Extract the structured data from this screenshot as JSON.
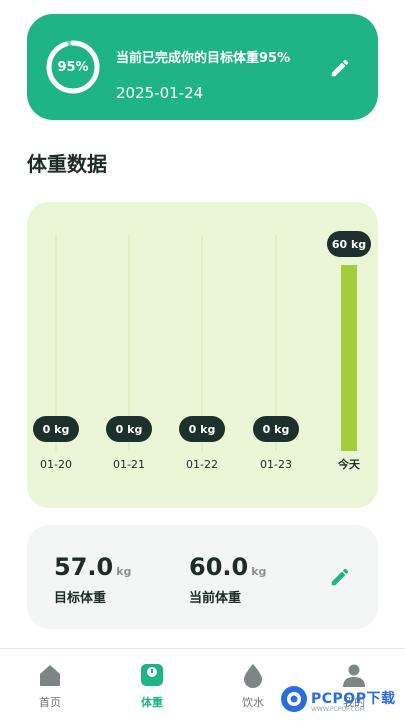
{
  "progress_card": {
    "percent_text": "95%",
    "percent_value": 0.95,
    "title": "当前已完成你的目标体重95%",
    "date": "2025-01-24"
  },
  "section": {
    "title": "体重数据"
  },
  "chart_data": {
    "type": "bar",
    "categories": [
      "01-20",
      "01-21",
      "01-22",
      "01-23",
      "今天"
    ],
    "values": [
      0,
      0,
      0,
      0,
      60
    ],
    "value_labels": [
      "0 kg",
      "0 kg",
      "0 kg",
      "0 kg",
      "60 kg"
    ],
    "colors": {
      "bar": "#a3cd3a",
      "track": "#d4e8b4",
      "label_bg": "#1e302c",
      "label_text": "#ffffff"
    }
  },
  "stats": {
    "target": {
      "value": "57.0",
      "unit": "kg",
      "label": "目标体重"
    },
    "current": {
      "value": "60.0",
      "unit": "kg",
      "label": "当前体重"
    }
  },
  "nav": {
    "items": [
      {
        "label": "首页",
        "icon": "home-icon",
        "active": false
      },
      {
        "label": "体重",
        "icon": "scale-icon",
        "active": true
      },
      {
        "label": "饮水",
        "icon": "water-drop-icon",
        "active": false
      },
      {
        "label": "我的",
        "icon": "user-icon",
        "active": false
      }
    ]
  },
  "watermark": {
    "text": "PCPOP下载",
    "sub": "WWW.PCPOP.COM"
  },
  "colors": {
    "accent": "#1fb486",
    "dark": "#1e2b28"
  }
}
